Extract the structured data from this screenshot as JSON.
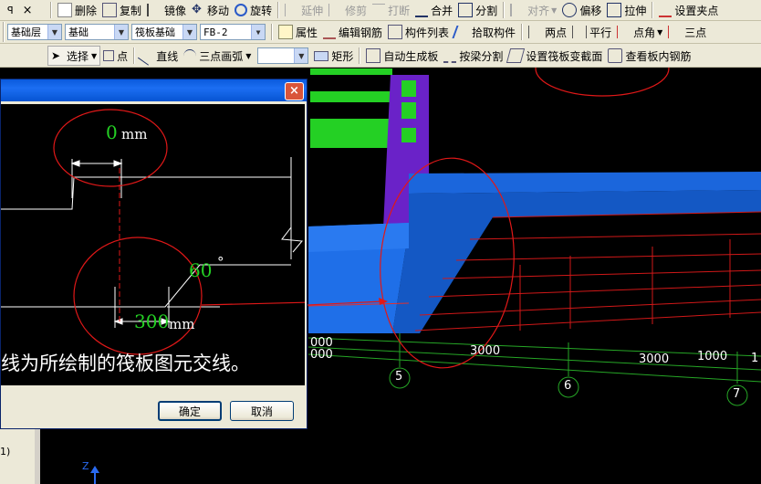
{
  "toolbar1": {
    "pin": "ꟼ",
    "close": "×",
    "items": [
      {
        "label": "删除",
        "icon": "delete-icon"
      },
      {
        "label": "复制",
        "icon": "copy-icon"
      },
      {
        "label": "镜像",
        "icon": "mirror-icon"
      },
      {
        "label": "移动",
        "icon": "move-icon"
      },
      {
        "label": "旋转",
        "icon": "rotate-icon"
      },
      {
        "label": "延伸",
        "icon": "extend-icon",
        "disabled": true
      },
      {
        "label": "修剪",
        "icon": "trim-icon",
        "disabled": true
      },
      {
        "label": "打断",
        "icon": "break-icon",
        "disabled": true
      },
      {
        "label": "合并",
        "icon": "merge-icon"
      },
      {
        "label": "分割",
        "icon": "split-icon"
      },
      {
        "label": "对齐",
        "icon": "align-icon",
        "disabled": true
      },
      {
        "label": "偏移",
        "icon": "offset-icon"
      },
      {
        "label": "拉伸",
        "icon": "stretch-icon"
      },
      {
        "label": "设置夹点",
        "icon": "grip-icon"
      }
    ]
  },
  "toolbar2": {
    "combos": [
      "基础层",
      "基础",
      "筏板基础",
      "FB-2"
    ],
    "items": [
      {
        "label": "属性",
        "icon": "properties-icon"
      },
      {
        "label": "编辑钢筋",
        "icon": "edit-rebar-icon"
      },
      {
        "label": "构件列表",
        "icon": "component-list-icon"
      },
      {
        "label": "拾取构件",
        "icon": "pick-component-icon"
      },
      {
        "label": "两点",
        "icon": "two-point-icon"
      },
      {
        "label": "平行",
        "icon": "parallel-icon"
      },
      {
        "label": "点角",
        "icon": "point-angle-icon"
      },
      {
        "label": "三点",
        "icon": "three-point-icon"
      }
    ]
  },
  "toolbar3": {
    "items": [
      {
        "label": "选择",
        "icon": "cursor-icon"
      },
      {
        "label": "点",
        "icon": "point-icon"
      },
      {
        "label": "直线",
        "icon": "line-icon"
      },
      {
        "label": "三点画弧",
        "icon": "arc-icon"
      },
      {
        "label": "矩形",
        "icon": "rectangle-icon"
      },
      {
        "label": "自动生成板",
        "icon": "auto-slab-icon"
      },
      {
        "label": "按梁分割",
        "icon": "split-by-beam-icon"
      },
      {
        "label": "设置筏板变截面",
        "icon": "raft-section-icon"
      },
      {
        "label": "查看板内钢筋",
        "icon": "view-rebar-icon"
      }
    ]
  },
  "dialog": {
    "close": "×",
    "diagram": {
      "offset_value": "0",
      "offset_unit": "mm",
      "angle_value": "60",
      "angle_unit": "°",
      "width_value": "300",
      "width_unit": "mm"
    },
    "caption": "线为所绘制的筏板图元交线。",
    "ok": "确定",
    "cancel": "取消"
  },
  "viewport": {
    "axis_labels": [
      "5",
      "6",
      "7"
    ],
    "dimensions": [
      "000",
      "000",
      "3000",
      "3000",
      "1000",
      "1"
    ],
    "z_axis": "Z"
  },
  "colors": {
    "raft_blue": "#1f6fe8",
    "column_purple": "#6a22c8",
    "beam_green": "#24d024",
    "rebar_red": "#d01818",
    "grid_green": "#26a626",
    "annotation_red": "#e01818"
  },
  "left_panel": {
    "text": "1)"
  }
}
